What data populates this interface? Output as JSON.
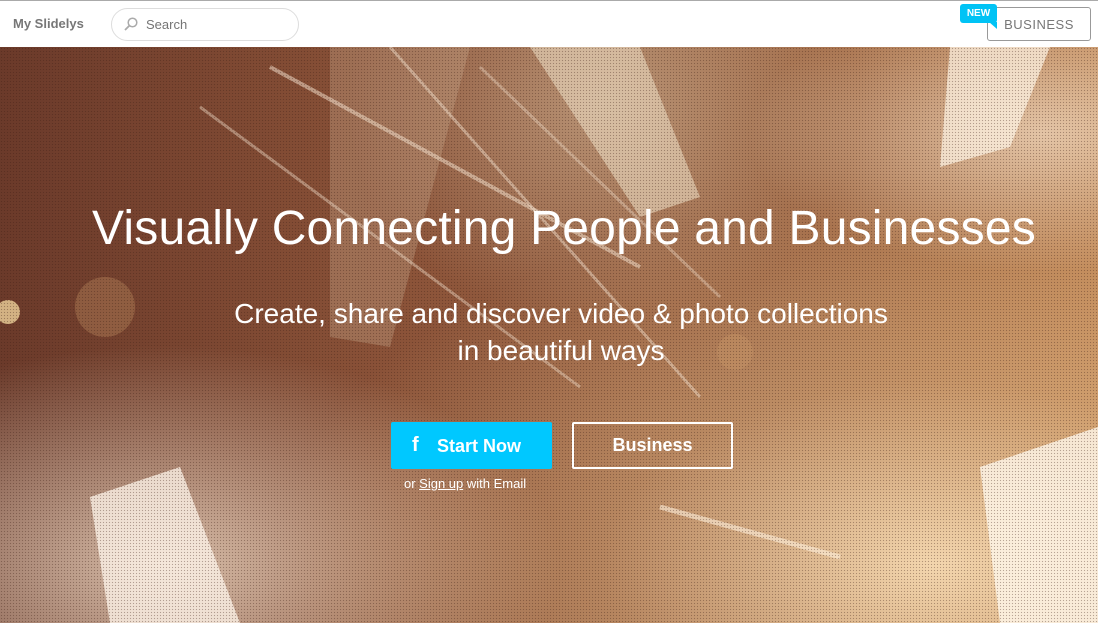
{
  "header": {
    "brand": "My Slidelys",
    "search_placeholder": "Search",
    "new_badge": "NEW",
    "business_label": "BUSINESS"
  },
  "hero": {
    "headline": "Visually Connecting People and Businesses",
    "subline_1": "Create, share and discover video & photo collections",
    "subline_2": "in beautiful ways",
    "start_icon": "f",
    "start_label": "Start Now",
    "business_label": "Business",
    "signup_prefix": "or ",
    "signup_link": "Sign up",
    "signup_suffix": " with Email"
  },
  "colors": {
    "accent": "#00c8ff"
  }
}
